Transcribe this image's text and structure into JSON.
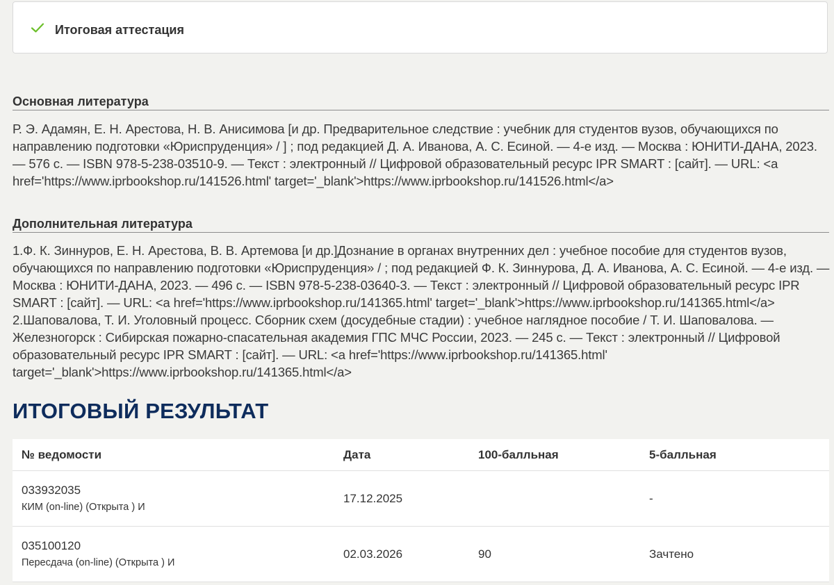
{
  "attestation_card": {
    "title": "Итоговая аттестация",
    "icon": "check-icon",
    "check_color": "#6cbf2a"
  },
  "main_literature": {
    "heading": "Основная литература",
    "text": "Р. Э. Адамян, Е. Н. Арестова, Н. В. Анисимова [и др. Предварительное следствие : учебник для студентов вузов, обучающихся по направлению подготовки «Юриспруденция» / ] ; под редакцией Д. А. Иванова, А. С. Есиной. — 4-е изд. — Москва : ЮНИТИ-ДАНА, 2023. — 576 с. — ISBN 978-5-238-03510-9. — Текст : электронный // Цифровой образовательный ресурс IPR SMART : [сайт]. — URL: <a href='https://www.iprbookshop.ru/141526.html' target='_blank'>https://www.iprbookshop.ru/141526.html</a>"
  },
  "additional_literature": {
    "heading": "Дополнительная литература",
    "text": "1.Ф. К. Зиннуров, Е. Н. Арестова, В. В. Артемова [и др.]Дознание в органах внутренних дел : учебное пособие для студентов вузов, обучающихся по направлению подготовки «Юриспруденция» / ; под редакцией Ф. К. Зиннурова, Д. А. Иванова, А. С. Есиной. — 4-е изд. — Москва : ЮНИТИ-ДАНА, 2023. — 496 с. — ISBN 978-5-238-03640-3. — Текст : электронный // Цифровой образовательный ресурс IPR SMART : [сайт]. — URL: <a href='https://www.iprbookshop.ru/141365.html' target='_blank'>https://www.iprbookshop.ru/141365.html</a> 2.Шаповалова, Т. И. Уголовный процесс. Сборник схем (досудебные стадии) : учебное наглядное пособие / Т. И. Шаповалова. — Железногорск : Сибирская пожарно-спасательная академия ГПС МЧС России, 2023. — 245 с. — Текст : электронный // Цифровой образовательный ресурс IPR SMART : [сайт]. — URL: <a href='https://www.iprbookshop.ru/141365.html' target='_blank'>https://www.iprbookshop.ru/141365.html</a>"
  },
  "final_result": {
    "heading": "ИТОГОВЫЙ РЕЗУЛЬТАТ",
    "heading_color": "#0e2c5c",
    "columns": [
      "№ ведомости",
      "Дата",
      "100-балльная",
      "5-балльная"
    ],
    "rows": [
      {
        "number": "033932035",
        "type": "КИМ (on-line) (Открыта ) И",
        "date": "17.12.2025",
        "score100": "",
        "score5": "-"
      },
      {
        "number": "035100120",
        "type": "Пересдача (on-line) (Открыта ) И",
        "date": "02.03.2026",
        "score100": "90",
        "score5": "Зачтено"
      }
    ]
  }
}
